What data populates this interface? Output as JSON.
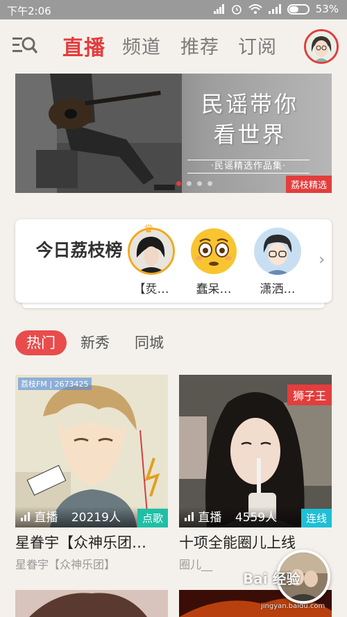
{
  "status_bar": {
    "time": "下午2:06",
    "battery": "53%",
    "battery_level": 0.53
  },
  "nav": {
    "tabs": [
      {
        "label": "直播",
        "active": true
      },
      {
        "label": "频道",
        "active": false
      },
      {
        "label": "推荐",
        "active": false
      },
      {
        "label": "订阅",
        "active": false
      }
    ],
    "icons": [
      "menu-search-icon",
      "avatar"
    ]
  },
  "banner": {
    "title_line1": "民谣带你",
    "title_line2": "看世界",
    "subtitle": "·民谣精选作品集·",
    "tag": "荔枝精选"
  },
  "ranking": {
    "title": "今日荔枝榜",
    "items": [
      {
        "name": "【烎…"
      },
      {
        "name": "蠢呆…"
      },
      {
        "name": "潇洒…"
      }
    ]
  },
  "sub_tabs": [
    {
      "label": "热门",
      "active": true
    },
    {
      "label": "新秀",
      "active": false
    },
    {
      "label": "同城",
      "active": false
    }
  ],
  "cards": [
    {
      "title": "星眷宇【众神乐团…",
      "subtitle": "星眷宇【众神乐团】",
      "live_label": "直播",
      "listeners": "20219人",
      "action": "点歌",
      "action_color": "#1fbfa6",
      "fm_tag": "荔枝FM | 2673425"
    },
    {
      "title": "十项全能圈儿上线",
      "subtitle": "圈儿__",
      "live_label": "直播",
      "listeners": "4559人",
      "action": "连线",
      "action_color": "#1fbfd6",
      "top_tag": "狮子王"
    }
  ],
  "watermark": {
    "text": "Bai 经验",
    "url": "jingyan.baidu.com"
  },
  "colors": {
    "accent": "#e33d3d",
    "background": "#f4f1ec"
  }
}
